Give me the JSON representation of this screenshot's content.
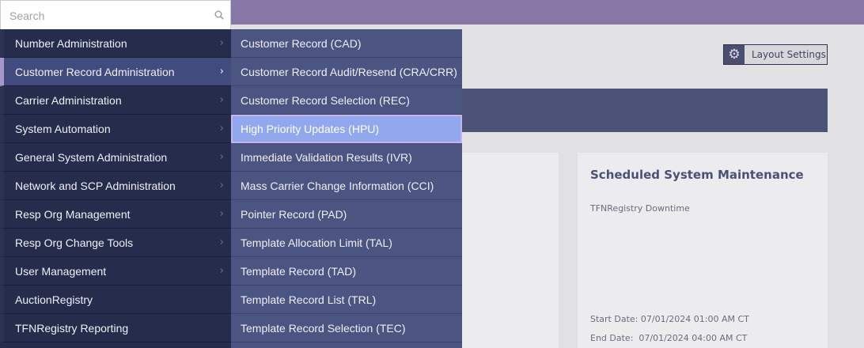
{
  "search": {
    "placeholder": "Search"
  },
  "menu": {
    "items": [
      {
        "label": "Number Administration",
        "has_submenu": true
      },
      {
        "label": "Customer Record Administration",
        "has_submenu": true,
        "active": true
      },
      {
        "label": "Carrier Administration",
        "has_submenu": true
      },
      {
        "label": "System Automation",
        "has_submenu": true
      },
      {
        "label": "General System Administration",
        "has_submenu": true
      },
      {
        "label": "Network and SCP Administration",
        "has_submenu": true
      },
      {
        "label": "Resp Org Management",
        "has_submenu": true
      },
      {
        "label": "Resp Org Change Tools",
        "has_submenu": true
      },
      {
        "label": "User Management",
        "has_submenu": true
      },
      {
        "label": "AuctionRegistry",
        "has_submenu": false
      },
      {
        "label": "TFNRegistry Reporting",
        "has_submenu": false
      }
    ]
  },
  "submenu": {
    "items": [
      {
        "label": "Customer Record (CAD)"
      },
      {
        "label": "Customer Record Audit/Resend (CRA/CRR)"
      },
      {
        "label": "Customer Record Selection (REC)"
      },
      {
        "label": "High Priority Updates (HPU)",
        "highlighted": true
      },
      {
        "label": "Immediate Validation Results (IVR)"
      },
      {
        "label": "Mass Carrier Change Information (CCI)"
      },
      {
        "label": "Pointer Record (PAD)"
      },
      {
        "label": "Template Allocation Limit (TAL)"
      },
      {
        "label": "Template Record (TAD)"
      },
      {
        "label": "Template Record List (TRL)"
      },
      {
        "label": "Template Record Selection (TEC)"
      }
    ]
  },
  "toolbar": {
    "layout_settings_label": "Layout Settings",
    "icon": "gear-icon"
  },
  "maintenance": {
    "title": "Scheduled System Maintenance",
    "subtitle": "TFNRegistry Downtime",
    "start": "Start Date: 07/01/2024 01:00 AM CT",
    "end": "End Date:  07/01/2024 04:00 AM CT"
  },
  "colors": {
    "topbar": "#8677a6",
    "menu_bg": "#262d4c",
    "menu_active": "#414b7d",
    "submenu_bg": "#4c5482",
    "submenu_highlight": "#91a7ee",
    "accent_border": "#a796c9"
  }
}
